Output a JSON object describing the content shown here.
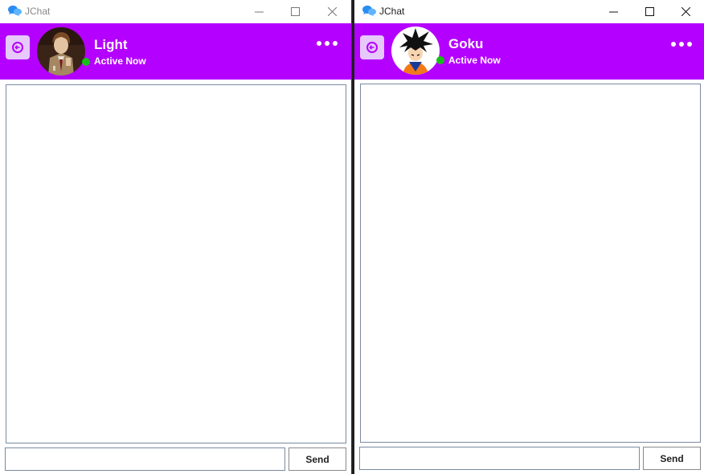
{
  "windows": [
    {
      "app_title": "JChat",
      "contact": {
        "name": "Light",
        "status": "Active Now",
        "avatar": "anime-portrait-light"
      },
      "message_input": {
        "value": "",
        "placeholder": ""
      },
      "send_label": "Send"
    },
    {
      "app_title": "JChat",
      "contact": {
        "name": "Goku",
        "status": "Active Now",
        "avatar": "anime-portrait-goku"
      },
      "message_input": {
        "value": "",
        "placeholder": ""
      },
      "send_label": "Send"
    }
  ],
  "colors": {
    "header": "#b400ff",
    "back_button": "#e6c9fa",
    "online_dot": "#17c017"
  },
  "icons": [
    "chat-bubbles-icon",
    "minimize-icon",
    "maximize-icon",
    "close-icon",
    "back-arrow-icon",
    "more-options-icon"
  ]
}
